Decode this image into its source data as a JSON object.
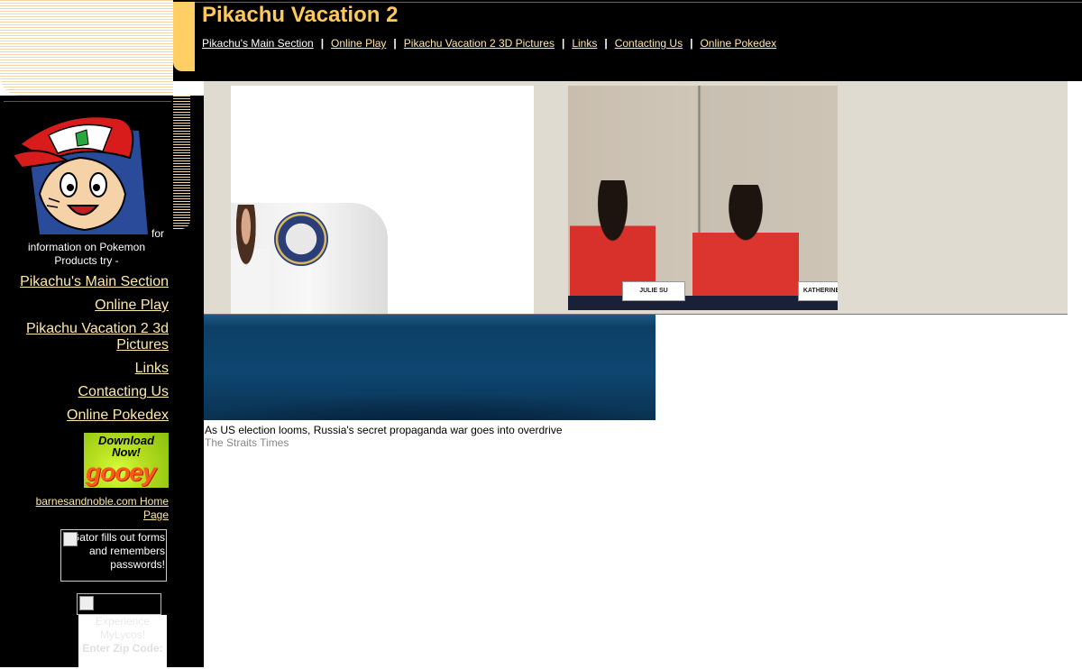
{
  "site": {
    "title": "Pikachu Vacation 2"
  },
  "top_nav": [
    "Pikachu's Main Section",
    "Online Play",
    "Pikachu Vacation 2 3D Pictures",
    "Links",
    "Contacting Us",
    "Online Pokedex"
  ],
  "top_nav_separator": "|",
  "sidebar": {
    "promo_for": "for",
    "promo_text": "information on Pokemon Products try -",
    "nav": [
      "Pikachu's Main Section",
      "Online Play",
      "Pikachu Vacation 2 3d Pictures",
      "Links",
      "Contacting Us",
      "Online Pokedex"
    ],
    "ad_gooey": {
      "tagline": "Download Now!",
      "brand": "gooey"
    },
    "bn_link": "barnesandnoble.com Home Page",
    "gator_text": "Gator fills out forms and remembers passwords!",
    "lycos": {
      "line1": "Experience MyLycos!",
      "line2": "Enter Zip Code:"
    }
  },
  "gallery": {
    "photo2_nameplates": [
      "JULIE SU",
      "KATHERINE"
    ]
  },
  "story": {
    "headline": "As US election looms, Russia's secret propaganda war goes into overdrive",
    "source": "The Straits Times"
  },
  "colors": {
    "header_bg": "#000000",
    "title": "#ffc85a",
    "link": "#ffe9a6",
    "accent_tab": "#ffcf66"
  }
}
